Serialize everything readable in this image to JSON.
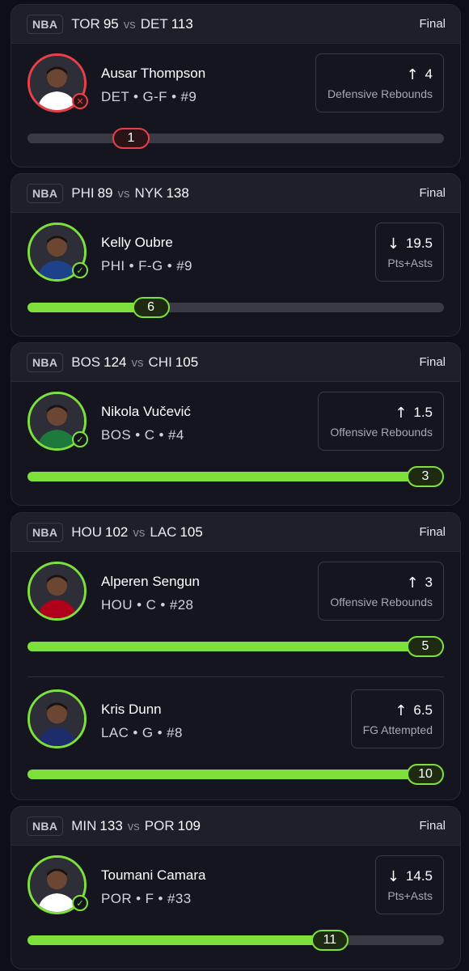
{
  "cards": [
    {
      "league": "NBA",
      "away_team": "TOR",
      "away_score": "95",
      "vs": "vs",
      "home_team": "DET",
      "home_score": "113",
      "status": "Final",
      "picks": [
        {
          "player": "Ausar Thompson",
          "meta": "DET • G-F • #9",
          "direction": "up",
          "arrow": "↑",
          "line": "4",
          "stat": "Defensive Rebounds",
          "actual": "1",
          "progress": 0.26,
          "result": "miss",
          "result_glyph": "✕",
          "jersey_color": "#ffffff"
        }
      ]
    },
    {
      "league": "NBA",
      "away_team": "PHI",
      "away_score": "89",
      "vs": "vs",
      "home_team": "NYK",
      "home_score": "138",
      "status": "Final",
      "picks": [
        {
          "player": "Kelly Oubre",
          "meta": "PHI • F-G • #9",
          "direction": "down",
          "arrow": "↓",
          "line": "19.5",
          "stat": "Pts+Asts",
          "actual": "6",
          "progress": 0.31,
          "result": "hit",
          "result_glyph": "✓",
          "jersey_color": "#1d428a"
        }
      ]
    },
    {
      "league": "NBA",
      "away_team": "BOS",
      "away_score": "124",
      "vs": "vs",
      "home_team": "CHI",
      "home_score": "105",
      "status": "Final",
      "picks": [
        {
          "player": "Nikola Vučević",
          "meta": "BOS • C • #4",
          "direction": "up",
          "arrow": "↑",
          "line": "1.5",
          "stat": "Offensive Rebounds",
          "actual": "3",
          "progress": 1.0,
          "result": "hit",
          "result_glyph": "✓",
          "jersey_color": "#1b7a3c"
        }
      ]
    },
    {
      "league": "NBA",
      "away_team": "HOU",
      "away_score": "102",
      "vs": "vs",
      "home_team": "LAC",
      "home_score": "105",
      "status": "Final",
      "picks": [
        {
          "player": "Alperen Sengun",
          "meta": "HOU • C • #28",
          "direction": "up",
          "arrow": "↑",
          "line": "3",
          "stat": "Offensive Rebounds",
          "actual": "5",
          "progress": 1.0,
          "result": "hit",
          "result_glyph": "",
          "jersey_color": "#b0001c"
        },
        {
          "player": "Kris Dunn",
          "meta": "LAC • G • #8",
          "direction": "up",
          "arrow": "↑",
          "line": "6.5",
          "stat": "FG Attempted",
          "actual": "10",
          "progress": 1.0,
          "result": "hit",
          "result_glyph": "",
          "jersey_color": "#1d2d6b"
        }
      ]
    },
    {
      "league": "NBA",
      "away_team": "MIN",
      "away_score": "133",
      "vs": "vs",
      "home_team": "POR",
      "home_score": "109",
      "status": "Final",
      "picks": [
        {
          "player": "Toumani Camara",
          "meta": "POR • F • #33",
          "direction": "down",
          "arrow": "↓",
          "line": "14.5",
          "stat": "Pts+Asts",
          "actual": "11",
          "progress": 0.76,
          "result": "hit",
          "result_glyph": "✓",
          "jersey_color": "#ffffff"
        }
      ]
    }
  ]
}
